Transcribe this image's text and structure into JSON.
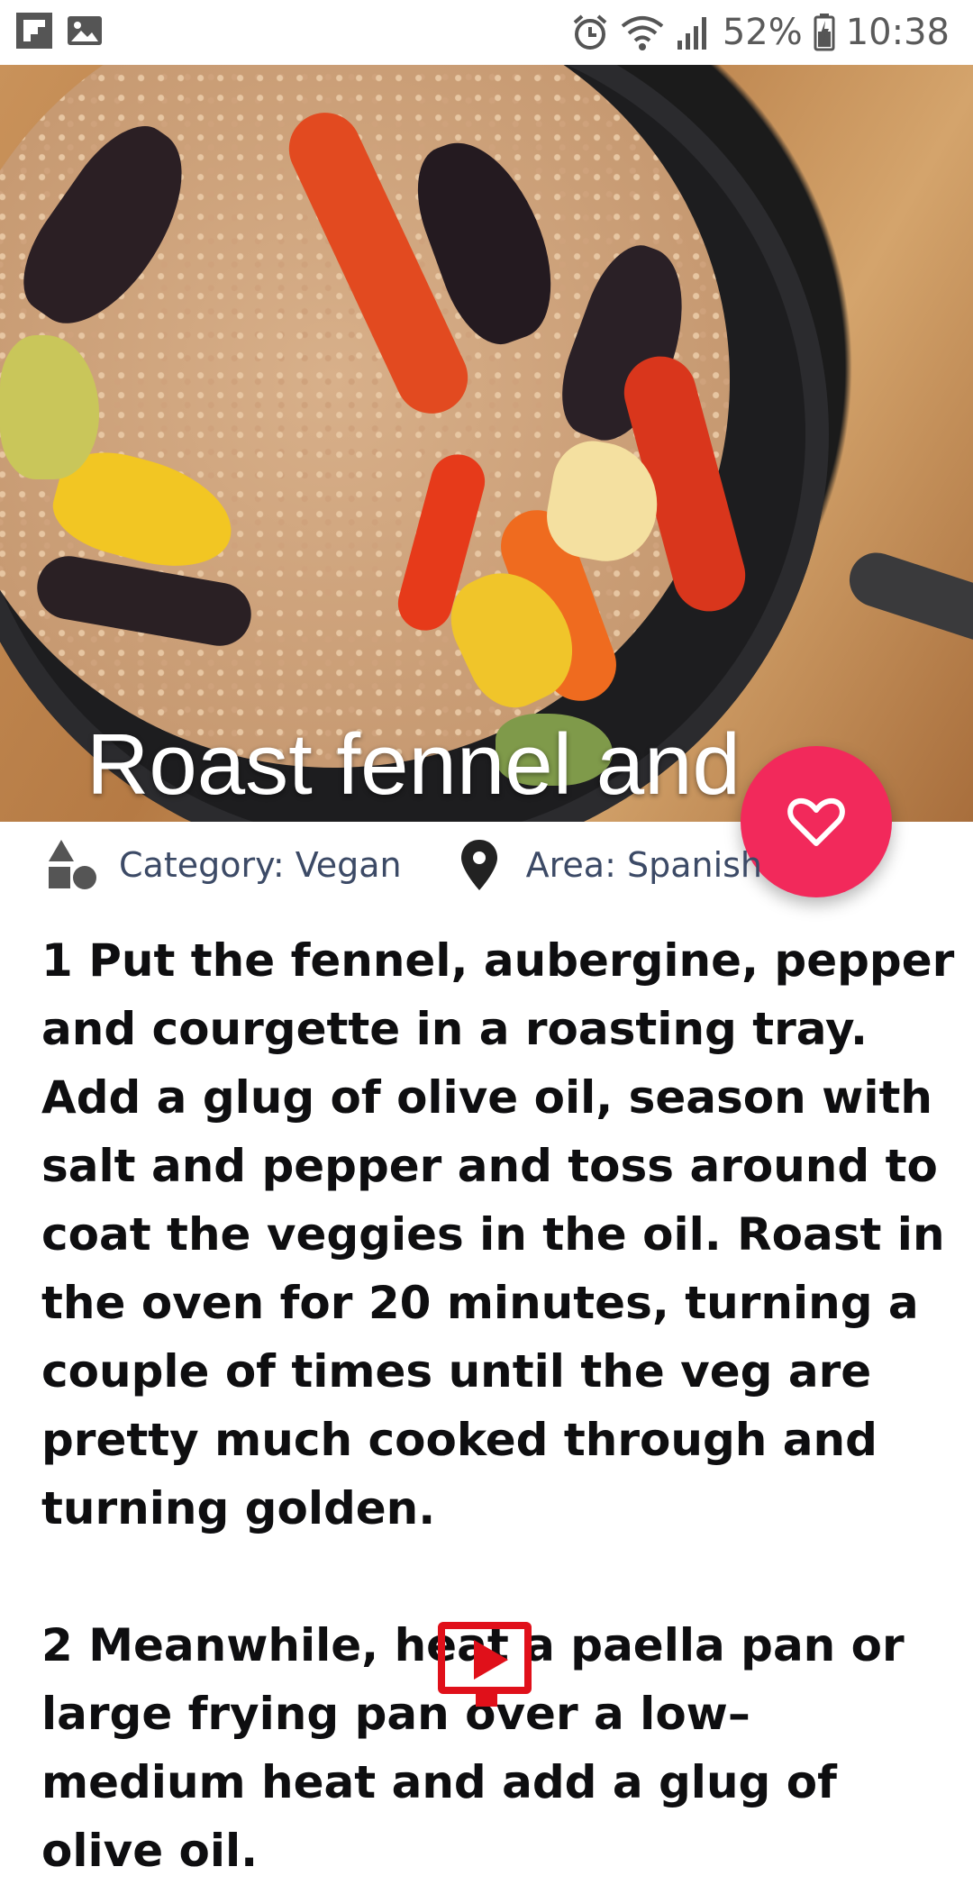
{
  "status_bar": {
    "battery": "52%",
    "time": "10:38",
    "left_icons": [
      "flipboard-icon",
      "image-icon"
    ],
    "right_icons": [
      "alarm-icon",
      "wifi-icon",
      "signal-icon",
      "battery-icon"
    ]
  },
  "hero": {
    "title": "Roast fennel and…"
  },
  "fab": {
    "icon": "heart-outline-icon",
    "color": "#f2295b"
  },
  "meta": {
    "category": "Category: Vegan",
    "area": "Area: Spanish"
  },
  "instructions": {
    "text": "1 Put the fennel, aubergine, pepper and courgette in a roasting tray. Add a glug of olive oil, season with salt and pepper and toss around to coat the veggies in the oil. Roast in the oven for 20 minutes, turning a couple of times until the veg are pretty much cooked through and turning golden.\n\n2 Meanwhile, heat a paella pan or large frying pan over a low– medium heat and add a glug of olive oil."
  },
  "youtube": {
    "icon": "youtube-play-icon",
    "color": "#e0101a"
  }
}
